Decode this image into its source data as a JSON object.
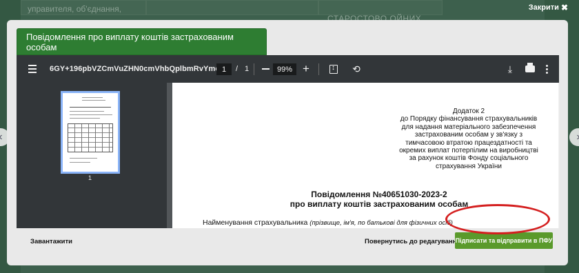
{
  "background": {
    "text_left": "управителя, об'єднання,",
    "text_right": "СТАРОСТОВО ОЙНИХ"
  },
  "close": {
    "label": "Закрити",
    "icon": "close-icon"
  },
  "modal": {
    "title": "Повідомлення про виплату коштів застрахованим особам"
  },
  "viewer": {
    "doc_name": "6GY+196pbVZCmVuZHN0cmVhbQplbmRvYmoK...",
    "page_current": "1",
    "page_separator": "/",
    "page_total": "1",
    "zoom": "99%",
    "thumb_page_num": "1",
    "page": {
      "annex_lines": [
        "Додаток 2",
        "до Порядку фінансування страхувальників",
        "для надання матеріального забезпечення",
        "застрахованим особам у зв'язку з",
        "тимчасовою втратою працездатності та",
        "окремих виплат потерпілим на виробництві",
        "за рахунок коштів Фонду соціального",
        "страхування України"
      ],
      "notice_line1": "Повідомлення №40651030-2023-2",
      "notice_line2": "про виплату коштів застрахованим особам",
      "insurer_label": "Найменування страхувальника",
      "insurer_hint": "(прізвище, ім'я, по батькові для фізичних осіб)"
    }
  },
  "footer": {
    "download_label": "Завантажити",
    "back_label": "Повернутись до редагування",
    "submit_label": "Підписати та відправити в ПФУ"
  },
  "colors": {
    "title_bar": "#2e7d32",
    "submit_button": "#5a9a2b",
    "highlight": "#d41f1f",
    "viewer_toolbar": "#323639"
  }
}
